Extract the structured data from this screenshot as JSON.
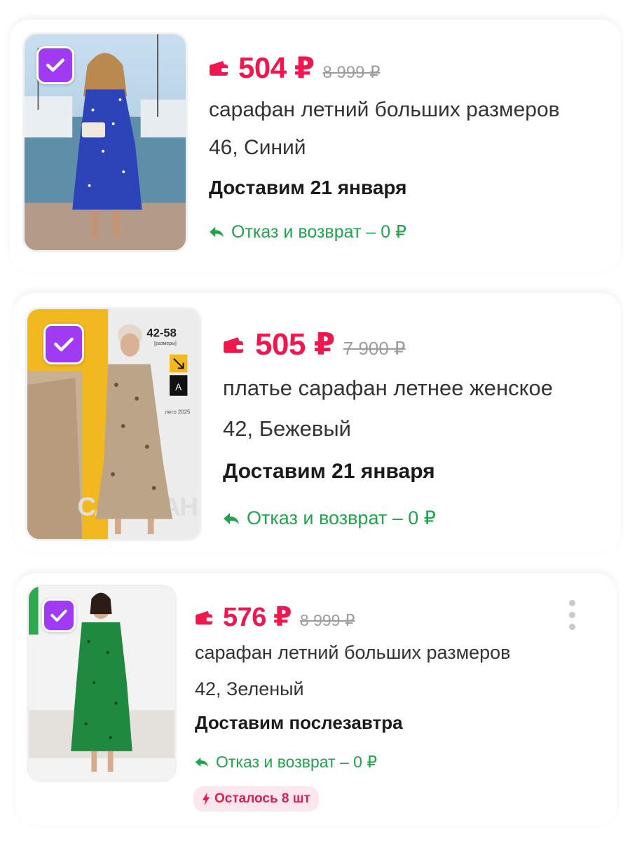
{
  "items": [
    {
      "price": "504 ₽",
      "old_price": "8 999 ₽",
      "title": "сарафан летний больших размеров",
      "variant": "46, Синий",
      "delivery": "Доставим 21 января",
      "return_text": "Отказ и возврат – 0 ₽",
      "selected": true
    },
    {
      "price": "505 ₽",
      "old_price": "7 900 ₽",
      "title": "платье сарафан летнее женское",
      "variant": "42, Бежевый",
      "delivery": "Доставим 21 января",
      "return_text": "Отказ и возврат – 0 ₽",
      "selected": true,
      "image_text": {
        "sizes": "42-58",
        "sizes_caption": "[размеры]",
        "brand_letter": "A",
        "season": "лето 2025",
        "big_word": "САРАФАН"
      }
    },
    {
      "price": "576 ₽",
      "old_price": "8 999 ₽",
      "title": "сарафан летний больших размеров",
      "variant": "42, Зеленый",
      "delivery": "Доставим послезавтра",
      "return_text": "Отказ и возврат – 0 ₽",
      "stock_badge": "Осталось 8 шт",
      "selected": true
    }
  ],
  "colors": {
    "accent_price": "#f0164e",
    "return_green": "#1fa44a",
    "check_purple": "#a13bf3",
    "old_price_gray": "#9c9c9c"
  },
  "icons": {
    "wallet": "wallet-icon",
    "return": "return-arrow-icon",
    "check": "checkmark-icon",
    "lightning": "lightning-icon",
    "more": "more-vertical-icon"
  }
}
